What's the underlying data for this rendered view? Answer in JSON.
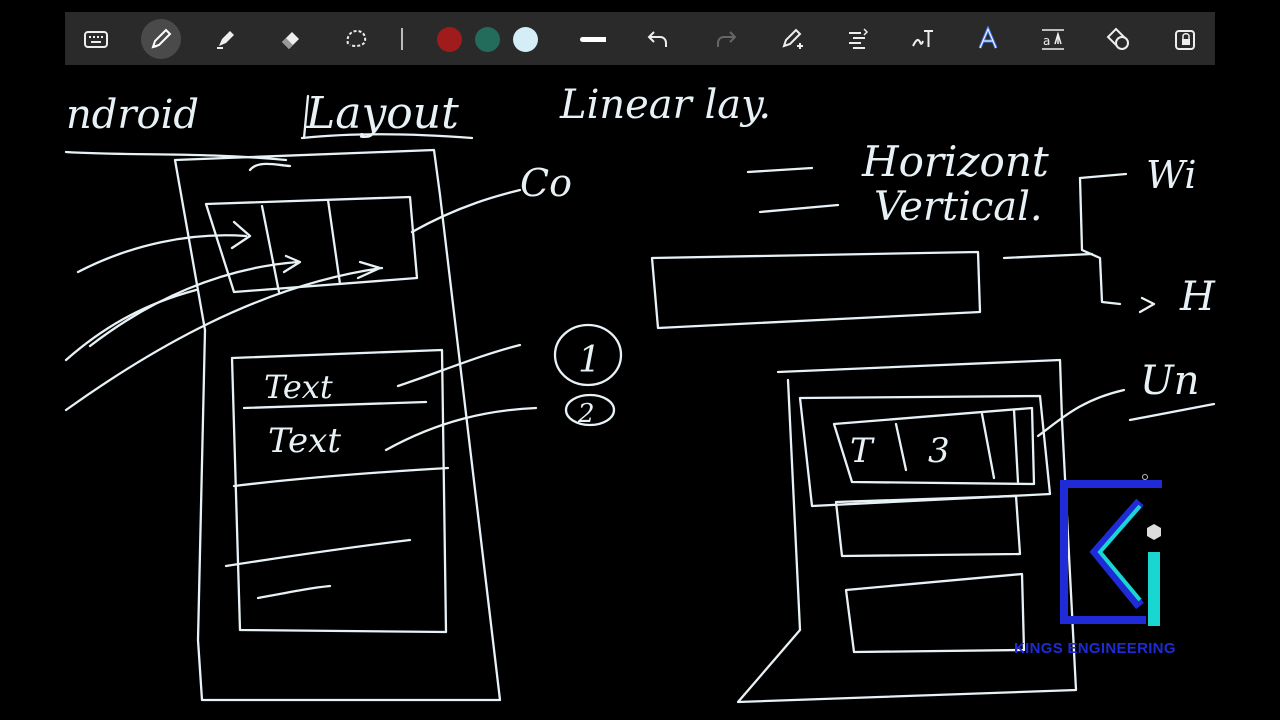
{
  "toolbar": {
    "tools": [
      {
        "name": "keyboard-icon"
      },
      {
        "name": "pen-icon",
        "active": true
      },
      {
        "name": "highlighter-icon"
      },
      {
        "name": "eraser-icon"
      },
      {
        "name": "lasso-icon"
      }
    ],
    "colors": [
      "#a01b1b",
      "#236b5b",
      "#d4edf6"
    ],
    "actions": [
      {
        "name": "stroke-width-icon"
      },
      {
        "name": "undo-icon"
      },
      {
        "name": "redo-icon",
        "disabled": true
      },
      {
        "name": "shape-pen-icon"
      },
      {
        "name": "text-align-icon"
      },
      {
        "name": "handwriting-to-text-icon"
      },
      {
        "name": "text-style-icon",
        "accent": "#4a7cf0"
      },
      {
        "name": "text-size-icon"
      },
      {
        "name": "shapes-icon"
      },
      {
        "name": "lock-icon"
      }
    ]
  },
  "board": {
    "ink_color": "#e8f2f6",
    "notes": {
      "title_left": "ndroid",
      "title_middle": "Layout",
      "title_right": "Linear lay.",
      "callout_top": "Co",
      "orient_1": "Horizont",
      "orient_2": "Vertical.",
      "branch_top": "Wi",
      "branch_bottom": "H",
      "list_item_1": "Text",
      "list_item_2": "Text",
      "circle_1": "1",
      "circle_2": "2",
      "cell_1": "T",
      "cell_2": "3",
      "right_label": "Un"
    }
  },
  "logo": {
    "text": "KINGS ENGINEERING",
    "colors": {
      "primary": "#1f2bd6",
      "accent": "#19d6d0"
    }
  }
}
